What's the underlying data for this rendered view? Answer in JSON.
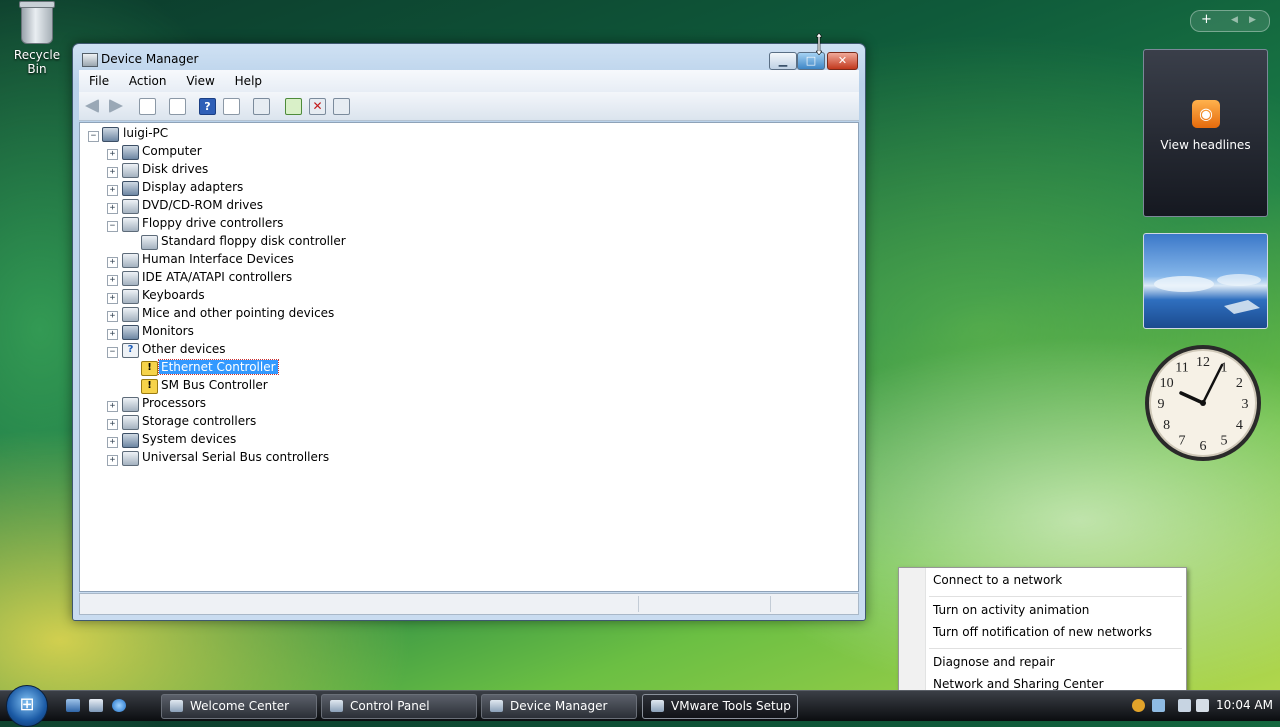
{
  "desktop": {
    "recycle_bin_label": "Recycle Bin"
  },
  "window": {
    "title": "Device Manager",
    "menu": [
      "File",
      "Action",
      "View",
      "Help"
    ],
    "toolbar_icons": [
      "back-arrow-icon",
      "forward-arrow-icon",
      "show-hide-tree-icon",
      "properties-icon",
      "help-icon",
      "resources-icon",
      "scan-hardware-icon",
      "update-driver-icon",
      "uninstall-icon",
      "disable-icon"
    ],
    "tree": {
      "root": "luigi-PC",
      "items": [
        {
          "label": "Computer",
          "expanded": false
        },
        {
          "label": "Disk drives",
          "expanded": false
        },
        {
          "label": "Display adapters",
          "expanded": false
        },
        {
          "label": "DVD/CD-ROM drives",
          "expanded": false
        },
        {
          "label": "Floppy drive controllers",
          "expanded": true,
          "children": [
            "Standard floppy disk controller"
          ]
        },
        {
          "label": "Human Interface Devices",
          "expanded": false
        },
        {
          "label": "IDE ATA/ATAPI controllers",
          "expanded": false
        },
        {
          "label": "Keyboards",
          "expanded": false
        },
        {
          "label": "Mice and other pointing devices",
          "expanded": false
        },
        {
          "label": "Monitors",
          "expanded": false
        },
        {
          "label": "Other devices",
          "expanded": true,
          "children": [
            "Ethernet Controller",
            "SM Bus Controller"
          ]
        },
        {
          "label": "Processors",
          "expanded": false
        },
        {
          "label": "Storage controllers",
          "expanded": false
        },
        {
          "label": "System devices",
          "expanded": false
        },
        {
          "label": "Universal Serial Bus controllers",
          "expanded": false
        }
      ],
      "selected": "Ethernet Controller"
    }
  },
  "gadgets": {
    "feed_text": "View headlines",
    "clock_numbers": [
      "12",
      "1",
      "2",
      "3",
      "4",
      "5",
      "6",
      "7",
      "8",
      "9",
      "10",
      "11"
    ],
    "add_glyph": "+",
    "prev_glyph": "◀",
    "next_glyph": "▶"
  },
  "context_menu": {
    "items": [
      "Connect to a network",
      "Turn on activity animation",
      "Turn off notification of new networks",
      "Diagnose and repair",
      "Network and Sharing Center"
    ]
  },
  "taskbar": {
    "buttons": [
      "Welcome Center",
      "Control Panel",
      "Device Manager",
      "VMware Tools Setup"
    ],
    "active": "VMware Tools Setup",
    "time": "10:04 AM"
  },
  "colors": {
    "selection": "#3399ff",
    "warning": "#f6d34a"
  }
}
